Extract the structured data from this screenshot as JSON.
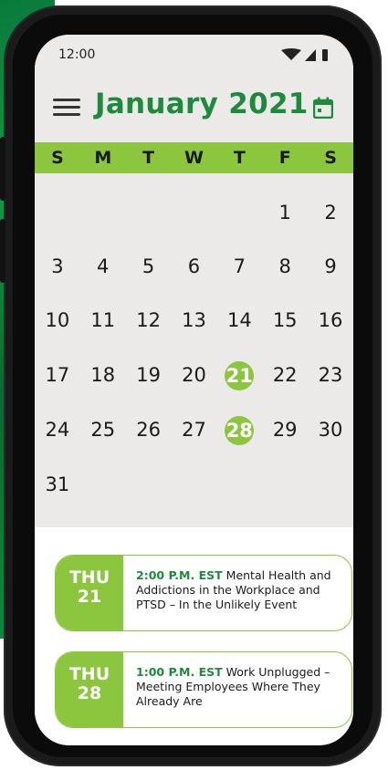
{
  "status_bar": {
    "time": "12:00"
  },
  "header": {
    "month_title": "January 2021"
  },
  "weekdays": [
    "S",
    "M",
    "T",
    "W",
    "T",
    "F",
    "S"
  ],
  "calendar": {
    "rows": [
      [
        "",
        "",
        "",
        "",
        "",
        "1",
        "2"
      ],
      [
        "3",
        "4",
        "5",
        "6",
        "7",
        "8",
        "9"
      ],
      [
        "10",
        "11",
        "12",
        "13",
        "14",
        "15",
        "16"
      ],
      [
        "17",
        "18",
        "19",
        "20",
        "21",
        "22",
        "23"
      ],
      [
        "24",
        "25",
        "26",
        "27",
        "28",
        "29",
        "30"
      ],
      [
        "31",
        "",
        "",
        "",
        "",
        "",
        ""
      ]
    ],
    "highlighted_days": [
      "21",
      "28"
    ]
  },
  "events": [
    {
      "dow": "THU",
      "day": "21",
      "time": "2:00 P.M. EST",
      "title": "Mental Health and Addictions in the Workplace and PTSD – In the Unlikely Event"
    },
    {
      "dow": "THU",
      "day": "28",
      "time": "1:00 P.M. EST",
      "title": "Work Unplugged – Meeting Employees Where They Already Are"
    }
  ],
  "colors": {
    "brand_green": "#1e8a3c",
    "accent_green": "#8cc63f",
    "panel_gray": "#eceae8"
  }
}
